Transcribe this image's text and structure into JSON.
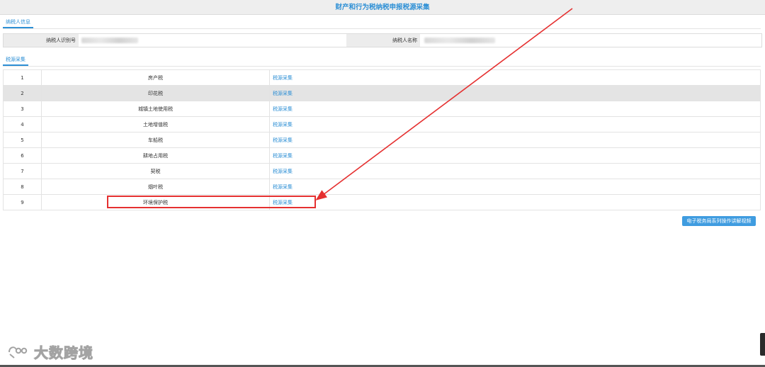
{
  "page_title": "财产和行为税纳税申报税源采集",
  "taxpayer_tab": "纳税人信息",
  "taxpayer_id_label": "纳税人识别号",
  "taxpayer_name_label": "纳税人名称",
  "source_tab": "税源采集",
  "rows": [
    {
      "index": "1",
      "tax_name": "房产税",
      "action": "税源采集"
    },
    {
      "index": "2",
      "tax_name": "印花税",
      "action": "税源采集"
    },
    {
      "index": "3",
      "tax_name": "城镇土地使用税",
      "action": "税源采集"
    },
    {
      "index": "4",
      "tax_name": "土地增值税",
      "action": "税源采集"
    },
    {
      "index": "5",
      "tax_name": "车船税",
      "action": "税源采集"
    },
    {
      "index": "6",
      "tax_name": "耕地占用税",
      "action": "税源采集"
    },
    {
      "index": "7",
      "tax_name": "契税",
      "action": "税源采集"
    },
    {
      "index": "8",
      "tax_name": "烟叶税",
      "action": "税源采集"
    },
    {
      "index": "9",
      "tax_name": "环境保护税",
      "action": "税源采集"
    }
  ],
  "highlighted_row": "2",
  "video_button_label": "电子税务局系列操作讲解视频",
  "watermark_text": "大数跨境",
  "colors": {
    "accent": "#2d8fd5",
    "annotation": "#e53030",
    "row_highlight": "#e4e4e4"
  }
}
